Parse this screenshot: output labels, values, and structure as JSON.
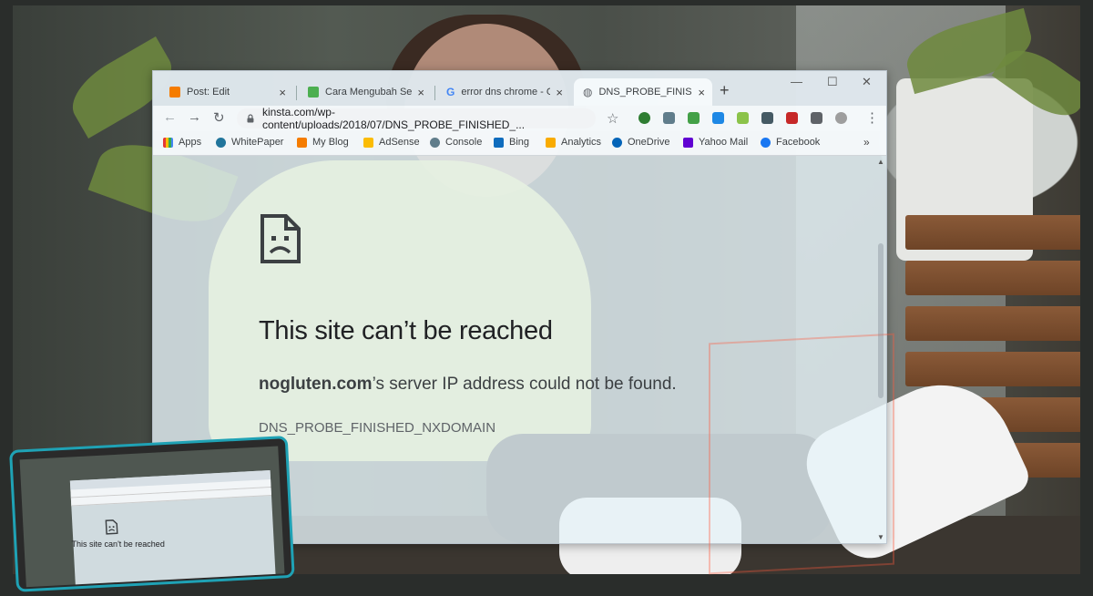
{
  "tabs": [
    {
      "label": "Post: Edit",
      "icon": "blogger-icon",
      "color": "#f57c00",
      "close": "×"
    },
    {
      "label": "Cara Mengubah Serv",
      "icon": "puzzle-leaf-icon",
      "color": "#4caf50",
      "close": "×"
    },
    {
      "label": "error dns chrome - G",
      "icon": "google-icon",
      "color": "#4285f4",
      "close": "×"
    },
    {
      "label": "DNS_PROBE_FINISHE",
      "icon": "globe-icon",
      "color": "#5f6368",
      "close": "×"
    }
  ],
  "new_tab": "+",
  "window_controls": {
    "minimize": "—",
    "maximize": "☐",
    "close": "✕"
  },
  "toolbar": {
    "back": "←",
    "forward": "→",
    "reload": "↻",
    "url": "kinsta.com/wp-content/uploads/2018/07/DNS_PROBE_FINISHED_...",
    "star": "☆",
    "menu": "⋮"
  },
  "extensions": [
    {
      "name": "extension-1-icon",
      "color": "#2e7d32"
    },
    {
      "name": "extension-2-icon",
      "color": "#607d8b"
    },
    {
      "name": "extension-3-icon",
      "color": "#43a047"
    },
    {
      "name": "extension-4-icon",
      "color": "#1e88e5"
    },
    {
      "name": "extension-5-icon",
      "color": "#8bc34a"
    },
    {
      "name": "extension-6-icon",
      "color": "#455a64"
    },
    {
      "name": "extension-7-icon",
      "color": "#c62828"
    },
    {
      "name": "extension-puzzle-icon",
      "color": "#5f6368"
    }
  ],
  "bookmarks": [
    {
      "label": "Apps",
      "color": "#e53935"
    },
    {
      "label": "WhitePaper",
      "color": "#21759b"
    },
    {
      "label": "My Blog",
      "color": "#f57c00"
    },
    {
      "label": "AdSense",
      "color": "#fbbc04"
    },
    {
      "label": "Console",
      "color": "#607d8b"
    },
    {
      "label": "Bing",
      "color": "#0f6cbd"
    },
    {
      "label": "Analytics",
      "color": "#f9ab00"
    },
    {
      "label": "OneDrive",
      "color": "#0364b8"
    },
    {
      "label": "Yahoo Mail",
      "color": "#6001d2"
    },
    {
      "label": "Facebook",
      "color": "#1877f2"
    }
  ],
  "bookmarks_more": "»",
  "error": {
    "title": "This site can’t be reached",
    "domain": "nogluten.com",
    "message": "’s server IP address could not be found.",
    "code": "DNS_PROBE_FINISHED_NXDOMAIN"
  },
  "laptop": {
    "title": "This site can't be reached"
  }
}
